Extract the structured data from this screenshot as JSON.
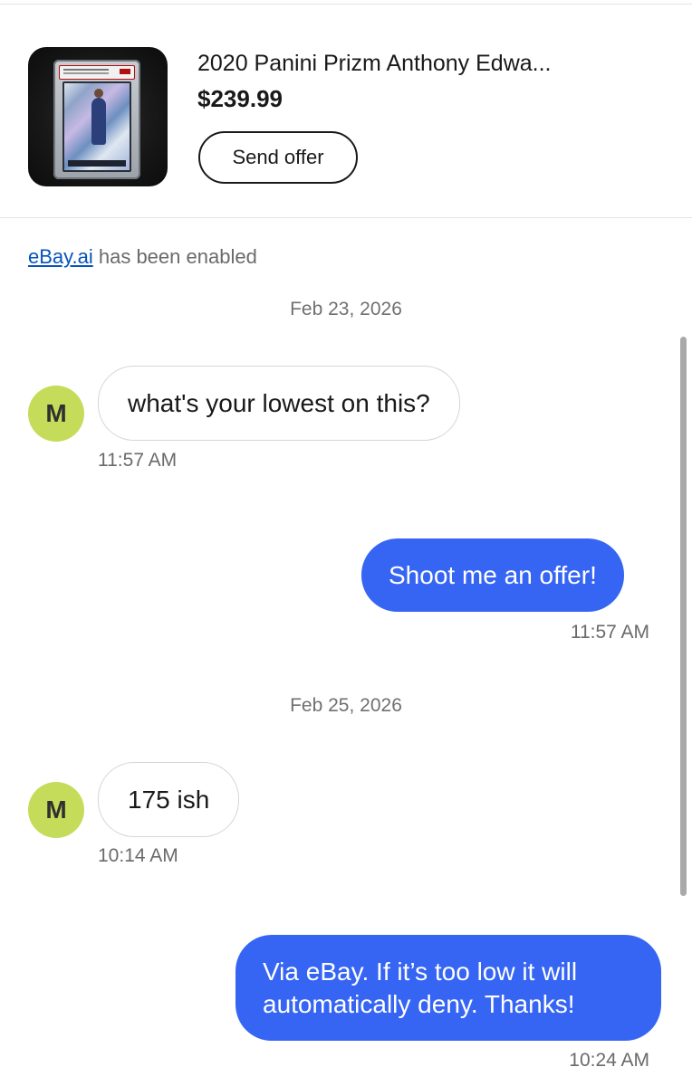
{
  "listing": {
    "title": "2020 Panini Prizm Anthony Edwa...",
    "price": "$239.99",
    "send_offer_label": "Send offer",
    "thumbnail_icon": "graded-card-image"
  },
  "notice": {
    "link_text": "eBay.ai",
    "text": " has been enabled"
  },
  "conversation": [
    {
      "date": "Feb 23, 2026",
      "messages": [
        {
          "direction": "incoming",
          "avatar": "M",
          "text": "what's your lowest on this?",
          "time": "11:57 AM"
        },
        {
          "direction": "outgoing",
          "text": "Shoot me an offer!",
          "time": "11:57 AM"
        }
      ]
    },
    {
      "date": "Feb 25, 2026",
      "messages": [
        {
          "direction": "incoming",
          "avatar": "M",
          "text": "175 ish",
          "time": "10:14 AM"
        },
        {
          "direction": "outgoing",
          "text": "Via eBay. If it’s too low it will automatically deny. Thanks!",
          "time": "10:24 AM"
        }
      ]
    }
  ],
  "colors": {
    "brand_blue": "#3665f3",
    "link_blue": "#0654ba",
    "avatar_green": "#c5dc5a",
    "text_dark": "#191919",
    "text_muted": "#6a6a6a"
  }
}
